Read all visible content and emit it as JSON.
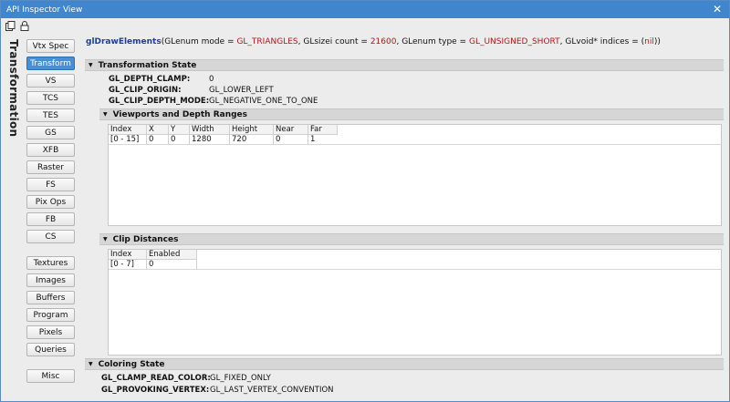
{
  "window": {
    "title": "API Inspector View",
    "close_glyph": "✕"
  },
  "toolbar": {
    "icons": [
      "copy-icon",
      "lock-icon"
    ]
  },
  "sidebar": {
    "vertical_label": "Transformation",
    "stages": [
      "Vtx Spec",
      "Transform",
      "VS",
      "TCS",
      "TES",
      "GS",
      "XFB",
      "Raster",
      "FS",
      "Pix Ops",
      "FB",
      "CS"
    ],
    "active_stage": "Transform",
    "resources": [
      "Textures",
      "Images",
      "Buffers",
      "Program",
      "Pixels",
      "Queries"
    ],
    "misc": "Misc"
  },
  "call": {
    "name": "glDrawElements",
    "open": "(",
    "p1_type": "GLenum mode = ",
    "p1_value": "GL_TRIANGLES",
    "sep1": ", ",
    "p2_type": "GLsizei count = ",
    "p2_value": "21600",
    "sep2": ", ",
    "p3_type": "GLenum type = ",
    "p3_value": "GL_UNSIGNED_SHORT",
    "sep3": ", ",
    "p4_type": "GLvoid* indices = ",
    "p4_open": "(",
    "p4_value": "nil",
    "p4_close": ")",
    "close": ")"
  },
  "transformation_state": {
    "title": "Transformation State",
    "props": [
      {
        "key": "GL_DEPTH_CLAMP:",
        "value": "0"
      },
      {
        "key": "GL_CLIP_ORIGIN:",
        "value": "GL_LOWER_LEFT"
      },
      {
        "key": "GL_CLIP_DEPTH_MODE:",
        "value": "GL_NEGATIVE_ONE_TO_ONE"
      }
    ]
  },
  "viewports": {
    "title": "Viewports and Depth Ranges",
    "columns": [
      "Index",
      "X",
      "Y",
      "Width",
      "Height",
      "Near",
      "Far"
    ],
    "rows": [
      [
        "[0 - 15]",
        "0",
        "0",
        "1280",
        "720",
        "0",
        "1"
      ]
    ]
  },
  "clip_distances": {
    "title": "Clip Distances",
    "columns": [
      "Index",
      "Enabled"
    ],
    "rows": [
      [
        "[0 - 7]",
        "0"
      ]
    ]
  },
  "coloring_state": {
    "title": "Coloring State",
    "props": [
      {
        "key": "GL_CLAMP_READ_COLOR:",
        "value": "GL_FIXED_ONLY"
      },
      {
        "key": "GL_PROVOKING_VERTEX:",
        "value": "GL_LAST_VERTEX_CONVENTION"
      }
    ]
  },
  "collapse_glyph": "▼",
  "colors": {
    "titlebar": "#3f86cf",
    "active_button": "#4a8fd2",
    "function_name": "#1a3fa0",
    "enum_value": "#b01818"
  }
}
